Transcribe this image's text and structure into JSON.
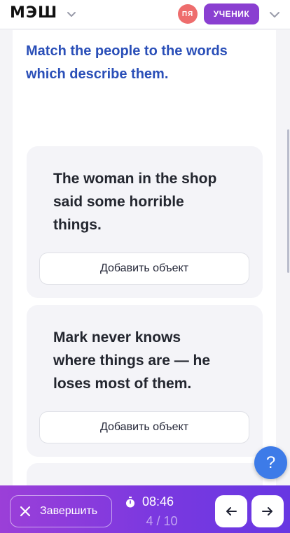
{
  "header": {
    "logo": "МЭШ",
    "avatar_initials": "ПЯ",
    "role_badge": "УЧЕНИК"
  },
  "question": {
    "prompt": "Match the people to the words which describe them."
  },
  "cards": [
    {
      "text": "The woman in the shop said some horrible things.",
      "add_label": "Добавить объект"
    },
    {
      "text": "Mark never knows where things are — he loses most of them.",
      "add_label": "Добавить объект"
    }
  ],
  "help": {
    "label": "?"
  },
  "footer": {
    "finish_label": "Завершить",
    "timer": "08:46",
    "progress": "4 / 10"
  },
  "colors": {
    "question_text": "#2a4fb8",
    "role_badge": "#8a3fd1",
    "avatar": "#ee6d6d",
    "help_button": "#3d7be8",
    "bottom_bar_start": "#9b3fd8",
    "bottom_bar_end": "#6737e2"
  }
}
